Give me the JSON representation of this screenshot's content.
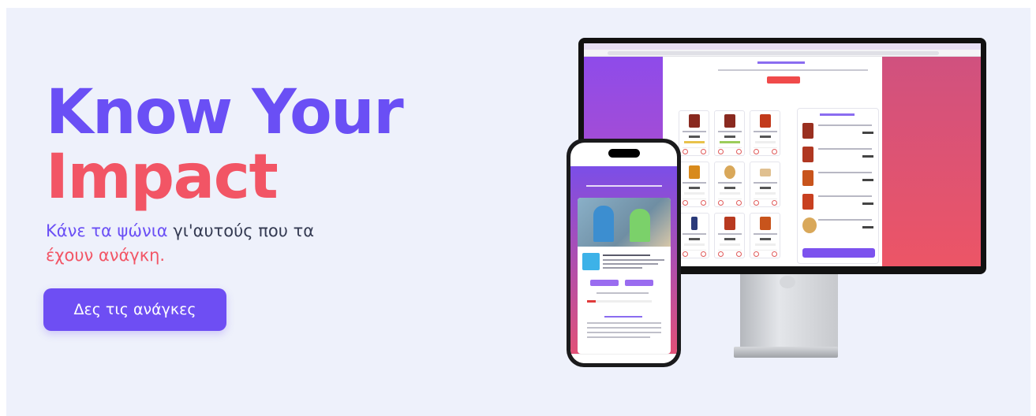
{
  "hero": {
    "title_line1": "Know Your",
    "title_line2": "Impact",
    "subtitle_purple": "Κάνε τα ψώνια",
    "subtitle_dark": " γι'αυτούς που τα",
    "subtitle_red": "έχουν ανάγκη.",
    "cta_label": "Δες τις ανάγκες"
  },
  "colors": {
    "background": "#eef1fb",
    "purple": "#6a4ff5",
    "red": "#f25565",
    "cta": "#6e4ef3"
  },
  "mockup": {
    "devices": [
      "desktop-monitor",
      "smartphone"
    ]
  }
}
